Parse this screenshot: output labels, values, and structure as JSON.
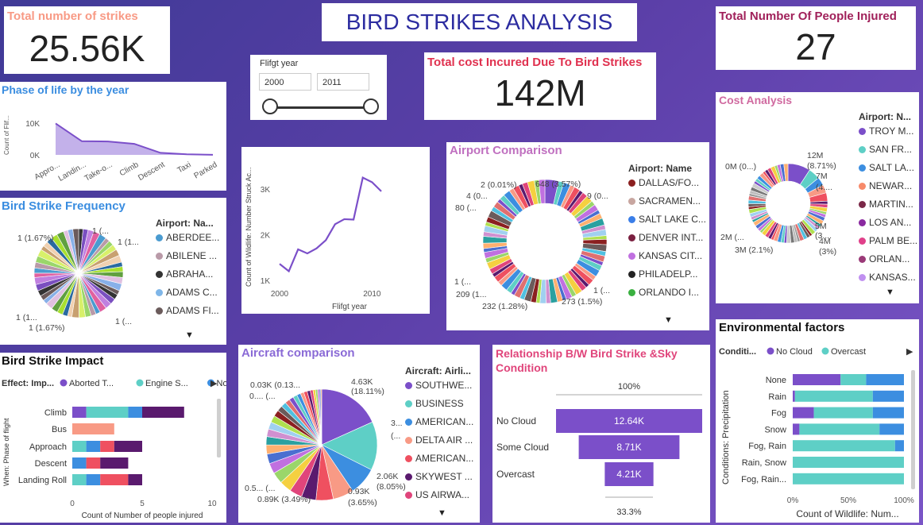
{
  "header": {
    "title": "BIRD STRIKES ANALYSIS"
  },
  "kpis": {
    "total_strikes": {
      "label": "Total number of strikes",
      "value": "25.56K"
    },
    "people_injured": {
      "label": "Total Number Of People Injured",
      "value": "27"
    },
    "total_cost": {
      "label": "Total cost Incured Due To Bird Strikes",
      "value": "142M"
    }
  },
  "slicer": {
    "label": "Flifgt year",
    "from": "2000",
    "to": "2011"
  },
  "colors": {
    "purple": "#7b4fc9",
    "teal": "#5ecfc6",
    "blue": "#3c8ee0",
    "red": "#ef5060",
    "darkpurple": "#5a1a6e",
    "salmon": "#f89a85",
    "accent_blue": "#3a8de0",
    "accent_pink": "#e0457b",
    "accent_orchid": "#c070c0",
    "title_dark": "#111111",
    "title_lavender": "#8a6ad6",
    "title_pink2": "#d06aa0",
    "title_salmon": "#e8847a",
    "title_red": "#e0314f"
  },
  "chart_data": [
    {
      "id": "phase_of_life",
      "type": "area",
      "title": "Phase of life by the year",
      "ylabel": "Count of Flif...",
      "categories": [
        "Appro...",
        "Landin...",
        "Take-o...",
        "Climb",
        "Descent",
        "Taxi",
        "Parked"
      ],
      "values": [
        10800,
        4700,
        4600,
        3800,
        700,
        200,
        50
      ],
      "ylim": [
        0,
        12000
      ],
      "yticks": [
        "10K",
        "0K"
      ]
    },
    {
      "id": "year_trend",
      "type": "line",
      "xlabel": "Flifgt year",
      "ylabel": "Count of Wildlife: Number Struck Ac...",
      "x": [
        2000,
        2001,
        2002,
        2003,
        2004,
        2005,
        2006,
        2007,
        2008,
        2009,
        2010,
        2011
      ],
      "values": [
        1360,
        1200,
        1680,
        1590,
        1700,
        1880,
        2230,
        2340,
        2330,
        3250,
        3150,
        2950
      ],
      "xticks": [
        "2000",
        "2010"
      ],
      "yticks": [
        "3K",
        "2K",
        "1K"
      ],
      "ylim": [
        1000,
        3400
      ]
    },
    {
      "id": "bird_strike_frequency",
      "type": "pie",
      "title": "Bird Strike Frequency",
      "legend_title": "Airport: Na...",
      "legend": [
        {
          "name": "ABERDEE...",
          "color": "#4a9bd0"
        },
        {
          "name": "ABILENE ...",
          "color": "#b99aa8"
        },
        {
          "name": "ABRAHA...",
          "color": "#333333"
        },
        {
          "name": "ADAMS C...",
          "color": "#7fb6e8"
        },
        {
          "name": "ADAMS FI...",
          "color": "#6b5b5b"
        }
      ],
      "labels": [
        "1 (1.67%)",
        "1 (...",
        "1 (1...",
        "1 (...",
        "1 (1...",
        "1 (1.67%)"
      ]
    },
    {
      "id": "airport_comparison",
      "type": "pie",
      "title": "Airport Comparison",
      "legend_title": "Airport: Name",
      "legend": [
        {
          "name": "DALLAS/FO...",
          "color": "#8b2020"
        },
        {
          "name": "SACRAMEN...",
          "color": "#c8a6a0"
        },
        {
          "name": "SALT LAKE C...",
          "color": "#3a7ee8"
        },
        {
          "name": "DENVER INT...",
          "color": "#7a2040"
        },
        {
          "name": "KANSAS CIT...",
          "color": "#c070e0"
        },
        {
          "name": "PHILADELP...",
          "color": "#222222"
        },
        {
          "name": "ORLANDO I...",
          "color": "#3ab040"
        }
      ],
      "labels": [
        "648 (3.57%)",
        "9 (0...",
        "2 (0.01%)",
        "4 (0...",
        "80 (...",
        "1 (...",
        "209 (1...",
        "232 (1.28%)",
        "273 (1.5%)",
        "1 (..."
      ]
    },
    {
      "id": "cost_analysis",
      "type": "pie",
      "title": "Cost Analysis",
      "legend_title": "Airport: N...",
      "legend": [
        {
          "name": "TROY M...",
          "color": "#7b4fc9"
        },
        {
          "name": "SAN FR...",
          "color": "#5ecfc6"
        },
        {
          "name": "SALT LA...",
          "color": "#3c8ee0"
        },
        {
          "name": "NEWAR...",
          "color": "#f78a6a"
        },
        {
          "name": "MARTIN...",
          "color": "#7a2848"
        },
        {
          "name": "LOS AN...",
          "color": "#8a2aa0"
        },
        {
          "name": "PALM BE...",
          "color": "#e0408a"
        },
        {
          "name": "ORLAN...",
          "color": "#9a3a78"
        },
        {
          "name": "KANSAS...",
          "color": "#c090f0"
        }
      ],
      "labels": [
        "12M",
        "(8.71%)",
        "7M",
        "(4....",
        "0M (0...)",
        "5M",
        "(3....",
        "4M",
        "(3%)",
        "2M (...",
        "3M (2.1%)"
      ]
    },
    {
      "id": "bird_strike_impact",
      "type": "bar",
      "title": "Bird Strike Impact",
      "legend_prefix": "Effect: Imp...",
      "xlabel": "Count of Number of people injured",
      "ylabel": "When: Phase of flight",
      "categories": [
        "Climb",
        "Bus",
        "Approach",
        "Descent",
        "Landing Roll"
      ],
      "xlim": [
        0,
        10
      ],
      "xticks": [
        "0",
        "5",
        "10"
      ],
      "series": [
        {
          "name": "Aborted T...",
          "color": "#7b4fc9",
          "values": [
            1,
            0,
            0,
            0,
            0
          ]
        },
        {
          "name": "Engine S...",
          "color": "#5ecfc6",
          "values": [
            3,
            0,
            1,
            0,
            1
          ]
        },
        {
          "name": "None",
          "color": "#3c8ee0",
          "values": [
            1,
            0,
            1,
            1,
            1
          ]
        },
        {
          "name": "",
          "color": "#ef5060",
          "values": [
            0,
            0,
            1,
            1,
            2
          ]
        },
        {
          "name": "",
          "color": "#5a1a6e",
          "values": [
            3,
            0,
            2,
            2,
            1
          ]
        },
        {
          "name": "",
          "color": "#f89a85",
          "values": [
            0,
            3,
            0,
            0,
            0
          ]
        }
      ]
    },
    {
      "id": "aircraft_comparison",
      "type": "pie",
      "title": "Aircraft comparison",
      "legend_title": "Aircraft: Airli...",
      "legend": [
        {
          "name": "SOUTHWE...",
          "color": "#7b4fc9"
        },
        {
          "name": "BUSINESS",
          "color": "#5ecfc6"
        },
        {
          "name": "AMERICAN...",
          "color": "#3c8ee0"
        },
        {
          "name": "DELTA AIR ...",
          "color": "#f89a85"
        },
        {
          "name": "AMERICAN...",
          "color": "#ef5060"
        },
        {
          "name": "SKYWEST ...",
          "color": "#5a1a6e"
        },
        {
          "name": "US AIRWA...",
          "color": "#e0457b"
        }
      ],
      "labels": [
        "4.63K",
        "(18.11%)",
        "3...",
        "(...",
        "2.06K",
        "(8.05%)",
        "0.93K",
        "(3.65%)",
        "0.89K (3.49%)",
        "0.5... (...",
        "0.03K (0.13...",
        "0.... (..."
      ]
    },
    {
      "id": "sky_condition",
      "type": "bar",
      "title": "Relationship B/W Bird Strike &Sky Condition",
      "categories": [
        "No Cloud",
        "Some Cloud",
        "Overcast"
      ],
      "values": [
        12640,
        8710,
        4210
      ],
      "value_labels": [
        "12.64K",
        "8.71K",
        "4.21K"
      ],
      "top_label": "100%",
      "bottom_label": "33.3%",
      "color": "#7b4fc9"
    },
    {
      "id": "environmental_factors",
      "type": "bar",
      "title": "Environmental factors",
      "legend_prefix": "Conditi...",
      "xlabel": "Count of Wildlife: Num...",
      "ylabel": "Conditions: Precipitation",
      "xticks": [
        "0%",
        "50%",
        "100%"
      ],
      "categories": [
        "None",
        "Rain",
        "Fog",
        "Snow",
        "Fog, Rain",
        "Rain, Snow",
        "Fog, Rain..."
      ],
      "series": [
        {
          "name": "",
          "color": "#7b4fc9",
          "values": [
            0.43,
            0.02,
            0.19,
            0.06,
            0,
            0,
            0
          ]
        },
        {
          "name": "No Cloud",
          "color": "#7b4fc9",
          "values": [
            0,
            0,
            0,
            0,
            0,
            0,
            0
          ]
        },
        {
          "name": "Overcast",
          "color": "#5ecfc6",
          "values": [
            0.23,
            0.7,
            0.53,
            0.72,
            0.92,
            1.0,
            1.0
          ]
        },
        {
          "name": "",
          "color": "#3c8ee0",
          "values": [
            0.34,
            0.28,
            0.28,
            0.22,
            0.08,
            0,
            0
          ]
        }
      ]
    }
  ]
}
